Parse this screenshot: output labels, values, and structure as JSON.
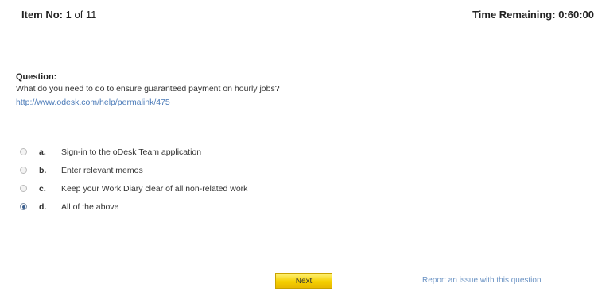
{
  "header": {
    "item_label": "Item No:",
    "item_value": "1 of 11",
    "time_remaining": "Time Remaining: 0:60:00"
  },
  "question": {
    "label": "Question:",
    "text": "What do you need to do to ensure guaranteed payment on hourly jobs?",
    "link": "http://www.odesk.com/help/permalink/475"
  },
  "options": [
    {
      "letter": "a.",
      "text": "Sign-in to the oDesk Team application",
      "selected": false
    },
    {
      "letter": "b.",
      "text": "Enter relevant memos",
      "selected": false
    },
    {
      "letter": "c.",
      "text": "Keep your Work Diary clear of all non-related work",
      "selected": false
    },
    {
      "letter": "d.",
      "text": "All of the above",
      "selected": true
    }
  ],
  "actions": {
    "next_label": "Next",
    "report_label": "Report an issue with this question"
  },
  "colors": {
    "link": "#4a7ab8",
    "next_button": "#f5cf00"
  }
}
